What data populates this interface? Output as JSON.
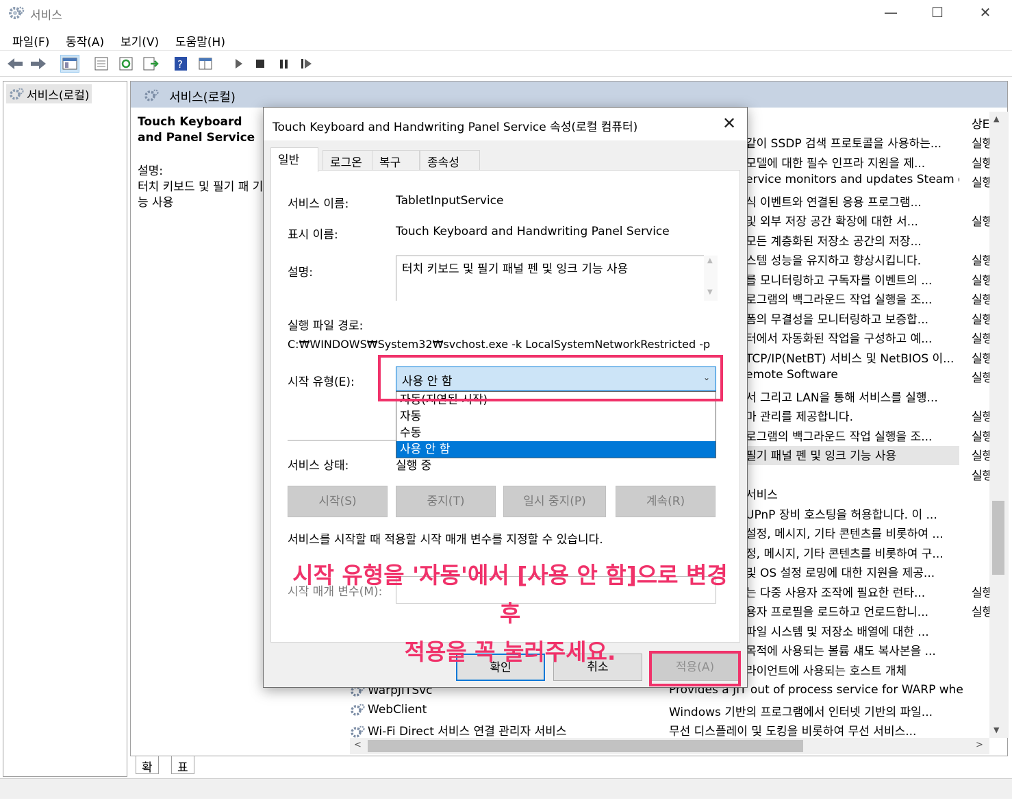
{
  "window": {
    "title": "서비스",
    "controls": {
      "minimize": "—",
      "maximize": "☐",
      "close": "✕"
    }
  },
  "menu": [
    "파일(F)",
    "동작(A)",
    "보기(V)",
    "도움말(H)"
  ],
  "tree": {
    "root": "서비스(로컬)"
  },
  "panel": {
    "header": "서비스(로컬)",
    "selected_title": "Touch Keyboard and Panel Service",
    "desc_label": "설명:",
    "desc_text": "터치 키보드 및 필기 패 기능 사용",
    "column_state": "상E"
  },
  "services": [
    {
      "desc": "같이 SSDP 검색 프로토콜을 사용하는...",
      "state": "실행"
    },
    {
      "desc": "모델에 대한 필수 인프라 지원을 제...",
      "state": "실행"
    },
    {
      "desc": "ervice monitors and updates Steam c...",
      "state": "실행"
    },
    {
      "desc": "식 이벤트와 연결된 응용 프로그램...",
      "state": ""
    },
    {
      "desc": "및 외부 저장 공간 확장에 대한 서...",
      "state": "실행"
    },
    {
      "desc": "모든 계층화된 저장소 공간의 저장...",
      "state": ""
    },
    {
      "desc": "스템 성능을 유지하고 향상시킵니다.",
      "state": "실행"
    },
    {
      "desc": "를 모니터링하고 구독자를 이벤트의 ...",
      "state": "실행"
    },
    {
      "desc": "로그램의 백그라운드 작업 실행을 조...",
      "state": "실행"
    },
    {
      "desc": "폼의 무결성을 모니터링하고 보증합...",
      "state": "실행"
    },
    {
      "desc": "터에서 자동화된 작업을 구성하고 예...",
      "state": "실행"
    },
    {
      "desc": "TCP/IP(NetBT) 서비스 및 NetBIOS 이...",
      "state": "실행"
    },
    {
      "desc": "emote Software",
      "state": "실행"
    },
    {
      "desc": "서 그리고 LAN을 통해 서비스를 실행...",
      "state": ""
    },
    {
      "desc": "마 관리를 제공합니다.",
      "state": "실행"
    },
    {
      "desc": "로그램의 백그라운드 작업 실행을 조...",
      "state": "실행"
    },
    {
      "desc": "필기 패널 펜 및 잉크 기능 사용",
      "state": "실행"
    },
    {
      "desc": "",
      "state": "실행"
    },
    {
      "desc": "서비스",
      "state": ""
    },
    {
      "desc": "UPnP 장비 호스팅을 허용합니다. 이 ...",
      "state": ""
    },
    {
      "desc": "설정, 메시지, 기타 콘텐츠를 비롯하여 ...",
      "state": ""
    },
    {
      "desc": "정, 메시지, 기타 콘텐츠를 비롯하여 구...",
      "state": ""
    },
    {
      "desc": "및 OS 설정 로밍에 대한 지원을 제공...",
      "state": ""
    },
    {
      "desc": "는 다중 사용자 조작에 필요한 런타...",
      "state": "실행"
    },
    {
      "desc": "용자 프로필을 로드하고 언로드합니...",
      "state": "실행"
    },
    {
      "desc": "파일 시스템 및 저장소 배열에 대한 ...",
      "state": ""
    },
    {
      "desc": "목적에 사용되는 볼륨 섀도 복사본을 ...",
      "state": ""
    },
    {
      "desc": "라이언트에 사용되는 호스트 개체",
      "state": ""
    }
  ],
  "bottom_rows": [
    {
      "name": "WarpJITSvc",
      "desc": "Provides a JIT out of process service for WARP whe..."
    },
    {
      "name": "WebClient",
      "desc": "Windows 기반의 프로그램에서 인터넷 기반의 파일..."
    },
    {
      "name": "Wi-Fi Direct 서비스 연결 관리자 서비스",
      "desc": "무선 디스플레이 및 도킹을 비롯하여 무선 서비스..."
    }
  ],
  "bottom_tabs": [
    "확장",
    "표준"
  ],
  "dialog": {
    "title": "Touch Keyboard and Handwriting Panel Service 속성(로컬 컴퓨터)",
    "close": "✕",
    "tabs": [
      "일반",
      "로그온",
      "복구",
      "종속성"
    ],
    "service_name_label": "서비스 이름:",
    "service_name": "TabletInputService",
    "display_name_label": "표시 이름:",
    "display_name": "Touch Keyboard and Handwriting Panel Service",
    "desc_label": "설명:",
    "desc_value": "터치 키보드 및 필기 패널 펜 및 잉크 기능 사용",
    "path_label": "실행 파일 경로:",
    "path_value": "C:₩WINDOWS₩System32₩svchost.exe -k LocalSystemNetworkRestricted -p",
    "startup_label": "시작 유형(E):",
    "startup_value": "사용 안 함",
    "startup_options": [
      "자동(지연된 시작)",
      "자동",
      "수동",
      "사용 안 함"
    ],
    "status_label": "서비스 상태:",
    "status_value": "실행 중",
    "buttons": {
      "start": "시작(S)",
      "stop": "중지(T)",
      "pause": "일시 중지(P)",
      "resume": "계속(R)"
    },
    "hint": "서비스를 시작할 때 적용할 시작 매개 변수를 지정할 수 있습니다.",
    "param_label": "시작 매개 변수(M):",
    "ok": "확인",
    "cancel": "취소",
    "apply": "적용(A)"
  },
  "annotation": {
    "line1": "시작 유형을 '자동'에서 [사용 안 함]으로 변경 후",
    "line2": "적용을 꼭 눌러주세요.",
    "color": "#f0326a"
  },
  "colors": {
    "header_bg": "#c7d3e3",
    "selection": "#0078d7",
    "combo_bg": "#cce4f7"
  }
}
